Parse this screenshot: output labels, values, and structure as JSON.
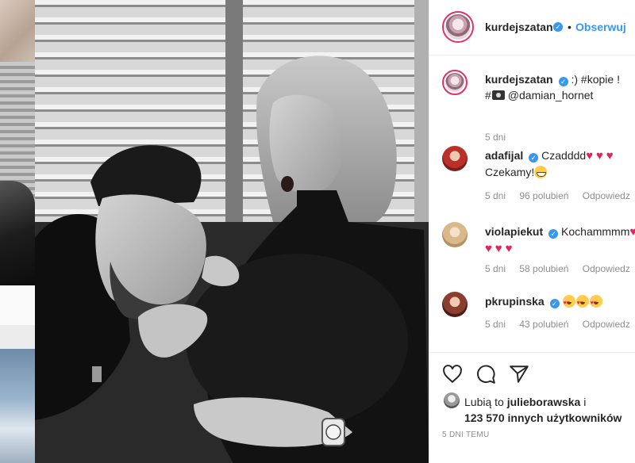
{
  "post": {
    "author": "kurdejszatan",
    "follow_label": "Obserwuj",
    "separator": "•",
    "caption": {
      "text_line1": ":) #kopie !",
      "text_line2_prefix": "#",
      "text_line2_mention": "@damian_hornet",
      "age": "5 dni"
    },
    "comments": [
      {
        "user": "adafijal",
        "text": "Czadddd",
        "text2": "Czekamy!",
        "age": "5 dni",
        "likes": "96 polubień",
        "reply": "Odpowiedz"
      },
      {
        "user": "violapiekut",
        "text": "Kochammmm",
        "age": "5 dni",
        "likes": "58 polubień",
        "reply": "Odpowiedz"
      },
      {
        "user": "pkrupinska",
        "text": "",
        "age": "5 dni",
        "likes": "43 polubień",
        "reply": "Odpowiedz"
      }
    ],
    "likes": {
      "prefix": "Lubią to",
      "first_user": "julieborawska",
      "connector": "i",
      "count": "123 570 innych użytkowników"
    },
    "time_ago": "5 DNI TEMU",
    "icons": {
      "verified": "verified-badge-icon",
      "like": "heart-outline-icon",
      "comment": "comment-bubble-icon",
      "share": "paper-plane-icon",
      "camera": "camera-emoji-icon",
      "heart_emoji": "red-heart-emoji",
      "grin_emoji": "grinning-face-emoji",
      "hearteyes_emoji": "heart-eyes-emoji"
    },
    "colors": {
      "link": "#3897f0",
      "verified": "#3897f0",
      "muted": "#8e8e8e",
      "text": "#262626",
      "heart": "#e0245e"
    }
  }
}
